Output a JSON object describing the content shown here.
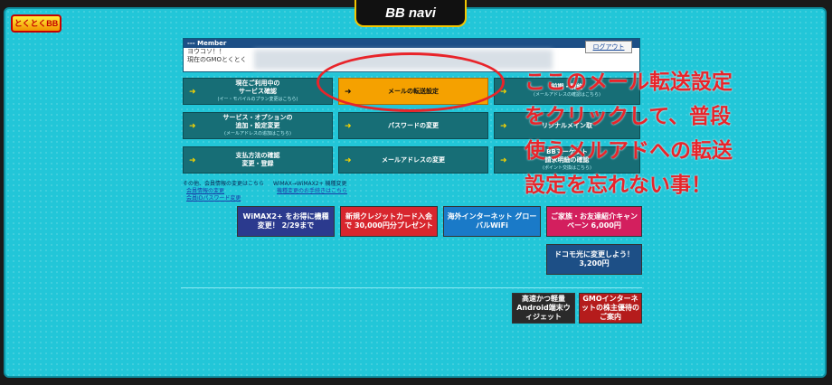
{
  "header": {
    "title": "BB navi",
    "logo_text": "とくとくBB"
  },
  "member": {
    "heading": "--- Member",
    "greeting": "ヨウコソ！！",
    "line2": "現在のGMOとくとく",
    "logout": "ログアウト"
  },
  "menu": [
    {
      "label": "現在ご利用中の\nサービス確認",
      "sub": "(イー・モバイルのプラン変更はこちら)"
    },
    {
      "label": "メールの転送設定",
      "sub": ""
    },
    {
      "label": "前期・解約",
      "sub": "(メールアドレスの確認はこちら)"
    },
    {
      "label": "サービス・オプションの\n追加・設定変更",
      "sub": "(メールアドレスの追加はこちら)"
    },
    {
      "label": "パスワードの変更",
      "sub": ""
    },
    {
      "label": "リジナルメイン取",
      "sub": ""
    },
    {
      "label": "支払方法の確認\n変更・登録",
      "sub": ""
    },
    {
      "label": "メールアドレスの変更",
      "sub": ""
    },
    {
      "label": "BBマーケット\n請求明細の確認",
      "sub": "(ポイント交換はこちら)"
    }
  ],
  "annotation": {
    "lines": [
      "ここのメール転送設定",
      "をクリックして、普段",
      "使うメルアドへの転送",
      "設定を忘れない事！"
    ]
  },
  "other_links": {
    "title": "その他、会員情報の変更はこちら",
    "items": [
      "会員情報の変更",
      "会員IDパスワード変更"
    ]
  },
  "wimax_links": {
    "title": "WiMAX→WiMAX2+ 機種変更",
    "items": [
      "機種変更のお手続きはこちら"
    ]
  },
  "banners": [
    {
      "text": "WiMAX2+ をお得に機種変更！ 2/29まで"
    },
    {
      "text": "新規クレジットカード入会で 30,000円分プレゼント"
    },
    {
      "text": "海外インターネット グローバルWiFi"
    },
    {
      "text": "ご家族・お友達紹介キャンペーン 6,000円"
    },
    {
      "text": "ドコモ光に変更しよう！ 3,200円"
    },
    {
      "text": "高速かつ軽量 Android端末ウィジェット"
    },
    {
      "text": "GMOインターネットの株主優待のご案内"
    }
  ],
  "colors": {
    "panel": "#22c6d8",
    "accent": "#f5a100",
    "annotation": "#e8242a"
  }
}
